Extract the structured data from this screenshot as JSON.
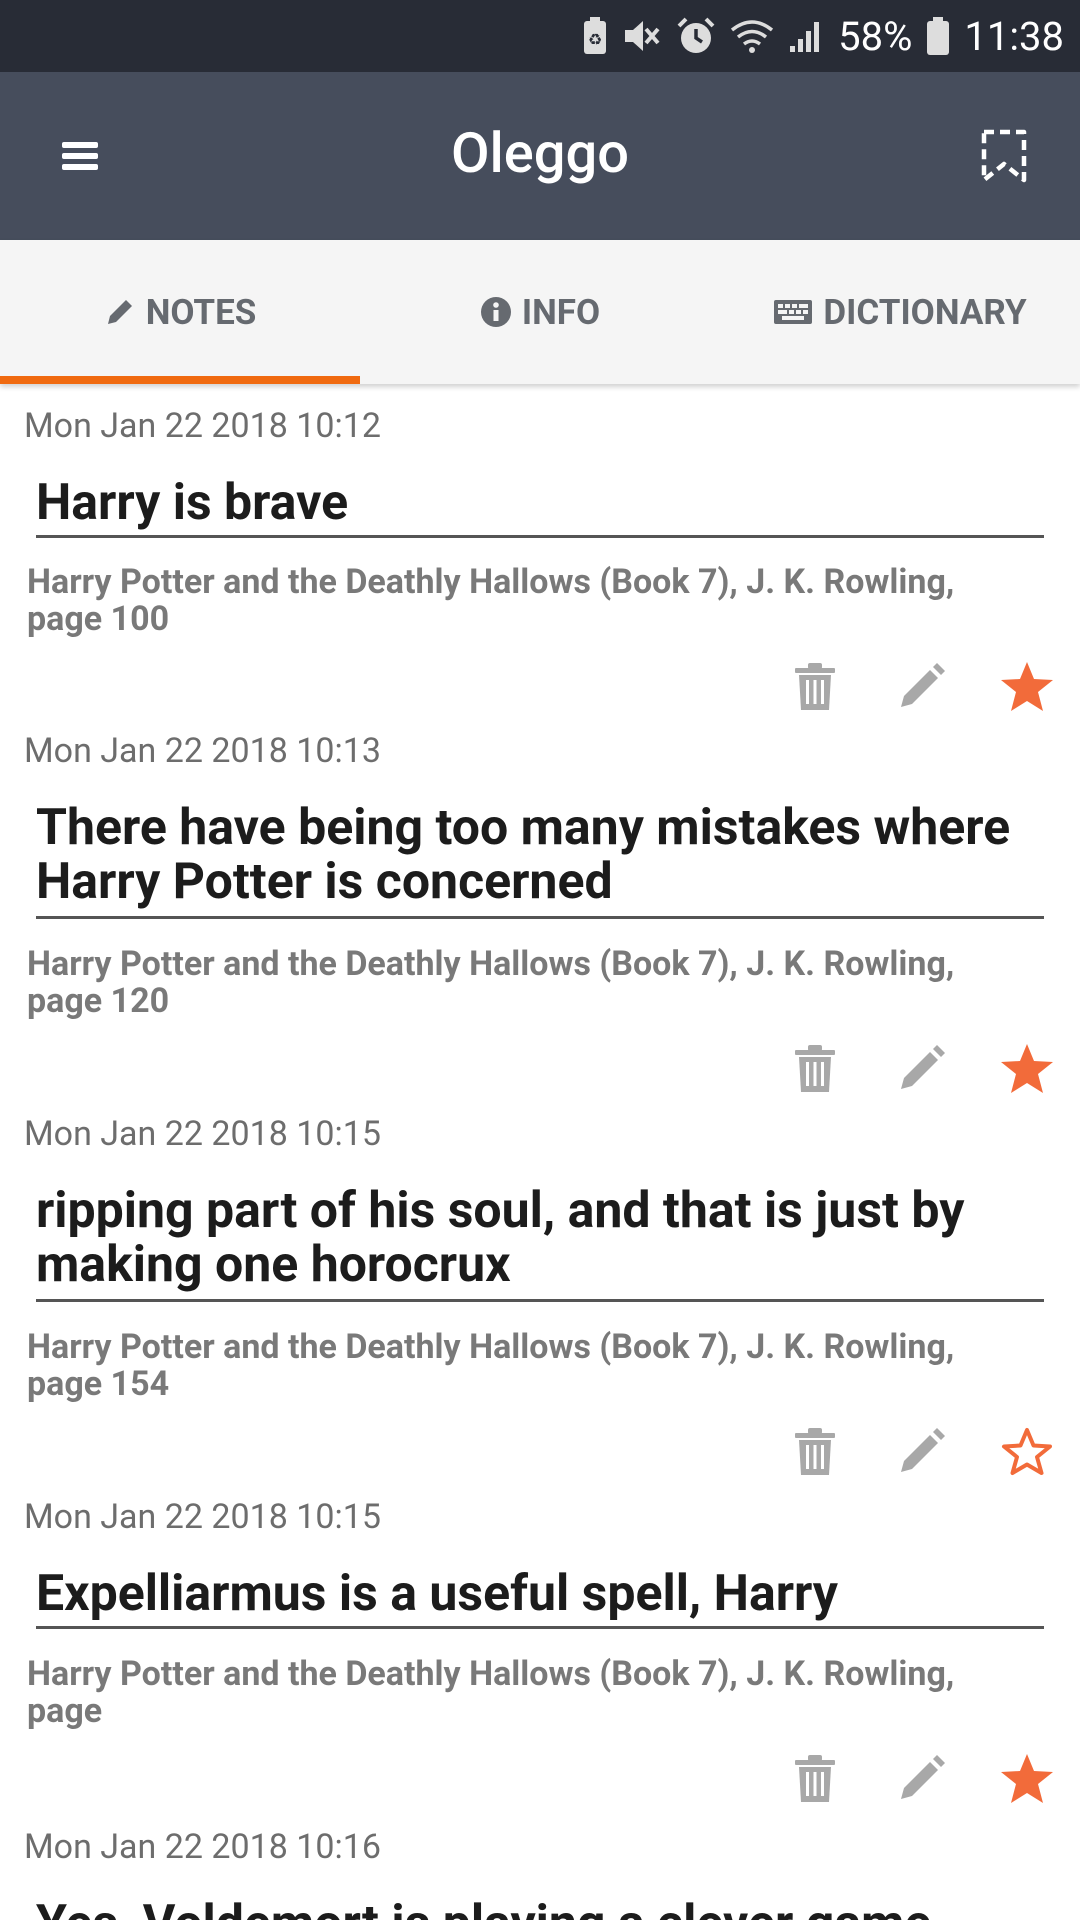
{
  "status_bar": {
    "battery_percent": "58%",
    "time": "11:38"
  },
  "app_bar": {
    "title": "Oleggo",
    "menu_icon": "menu-icon",
    "bookmark_icon": "bookmark-outline-icon"
  },
  "tabs": [
    {
      "label": "NOTES",
      "icon": "pencil-icon",
      "active": true
    },
    {
      "label": "INFO",
      "icon": "info-circle-icon",
      "active": false
    },
    {
      "label": "DICTIONARY",
      "icon": "keyboard-icon",
      "active": false
    }
  ],
  "colors": {
    "accent": "#f06a10",
    "star": "#f26b3a",
    "app_bar": "#464d5c",
    "status_bar": "#282c36"
  },
  "notes": [
    {
      "timestamp": "Mon Jan 22 2018 10:12",
      "title": "Harry is brave",
      "source": "Harry Potter and the Deathly Hallows (Book 7), J. K. Rowling, page 100",
      "starred": true
    },
    {
      "timestamp": "Mon Jan 22 2018 10:13",
      "title": "There have being too many mistakes where Harry Potter is concerned",
      "source": "Harry Potter and the Deathly Hallows (Book 7), J. K. Rowling, page 120",
      "starred": true
    },
    {
      "timestamp": "Mon Jan 22 2018 10:15",
      "title": "ripping part of his soul, and that is just by making one horocrux",
      "source": "Harry Potter and the Deathly Hallows (Book 7), J. K. Rowling, page 154",
      "starred": false
    },
    {
      "timestamp": "Mon Jan 22 2018 10:15",
      "title": "Expelliarmus is a useful spell, Harry",
      "source": "Harry Potter and the Deathly Hallows (Book 7), J. K. Rowling, page",
      "starred": true
    },
    {
      "timestamp": "Mon Jan 22 2018 10:16",
      "title": "Yes, Voldemort is playing a clever game",
      "source": "",
      "starred": false
    }
  ]
}
